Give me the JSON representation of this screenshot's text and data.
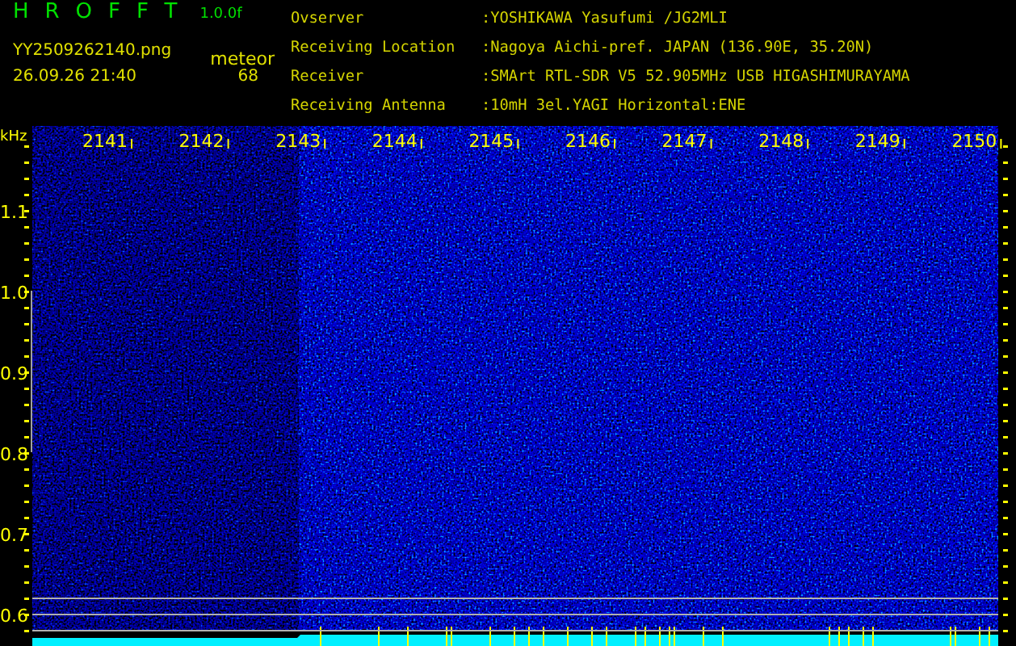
{
  "app": {
    "title": "HROFFT",
    "version": "1.0.0f"
  },
  "file": {
    "name": "YY2509262140.png",
    "timestamp": "26.09.26 21:40",
    "mode": "meteor",
    "count": "68"
  },
  "station_info": [
    {
      "label": "Ovserver",
      "value": ":YOSHIKAWA Yasufumi /JG2MLI"
    },
    {
      "label": "Receiving Location",
      "value": ":Nagoya Aichi-pref. JAPAN (136.90E, 35.20N)"
    },
    {
      "label": "Receiver",
      "value": ":SMArt RTL-SDR V5 52.905MHz USB HIGASHIMURAYAMA"
    },
    {
      "label": "Receiving Antenna",
      "value": ":10mH 3el.YAGI Horizontal:ENE"
    }
  ],
  "spectrogram": {
    "x_unit": "kHz",
    "x_labels": [
      "2141",
      "2142",
      "2143",
      "2144",
      "2145",
      "2146",
      "2147",
      "2148",
      "2149",
      "2150"
    ],
    "y_labels": [
      "1.1",
      "1.0",
      "0.9",
      "0.8",
      "0.7",
      "0.6"
    ]
  }
}
